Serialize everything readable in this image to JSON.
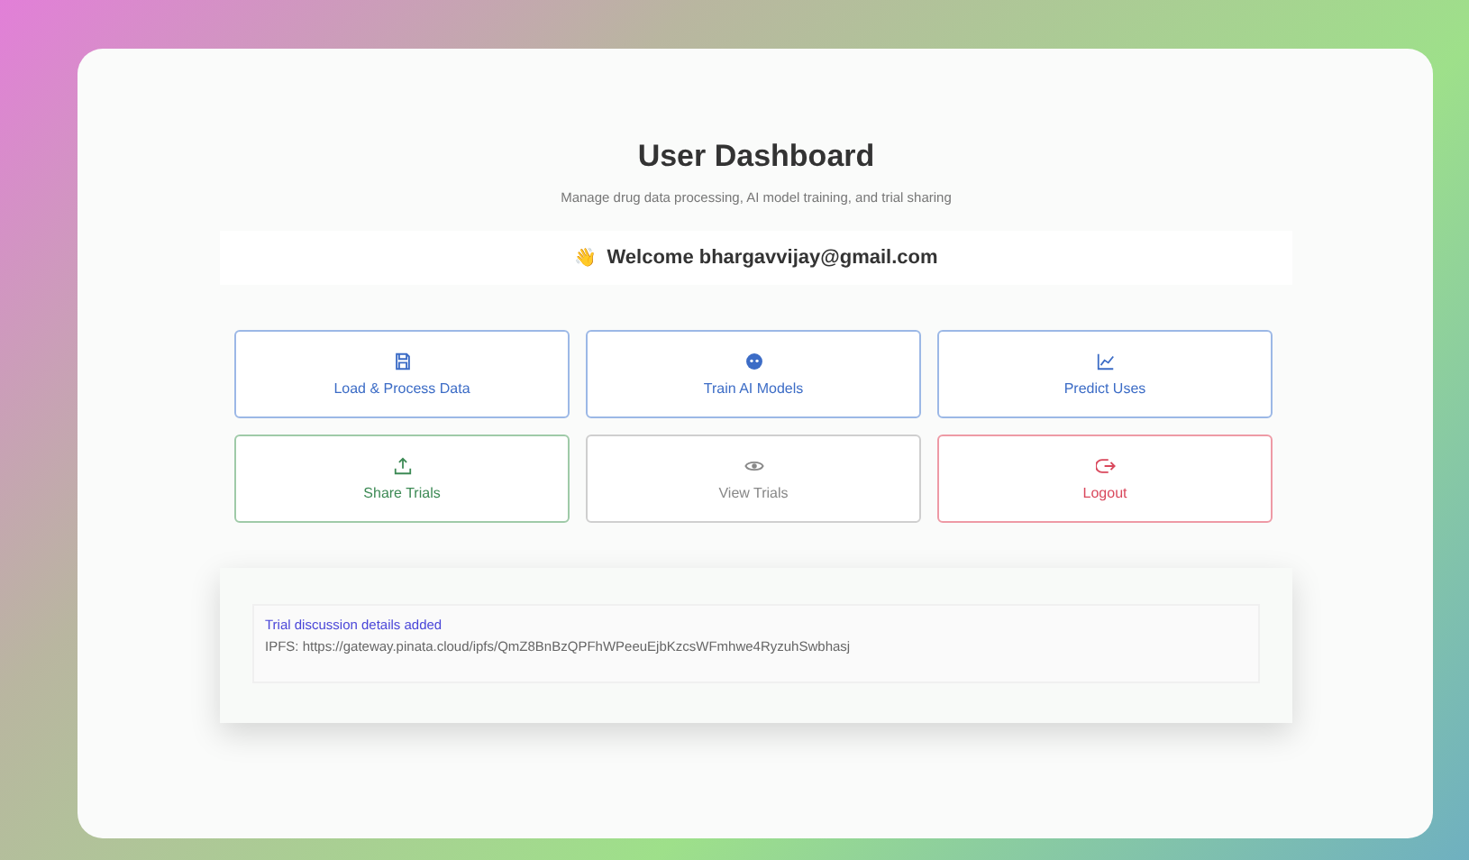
{
  "header": {
    "title": "User Dashboard",
    "subtitle": "Manage drug data processing, AI model training, and trial sharing"
  },
  "welcome": {
    "wave": "👋",
    "text": "Welcome bhargavvijay@gmail.com"
  },
  "actions": [
    {
      "label": "Load & Process Data",
      "kind": "primary"
    },
    {
      "label": "Train AI Models",
      "kind": "primary"
    },
    {
      "label": "Predict Uses",
      "kind": "primary"
    },
    {
      "label": "Share Trials",
      "kind": "success"
    },
    {
      "label": "View Trials",
      "kind": "neutral"
    },
    {
      "label": "Logout",
      "kind": "danger"
    }
  ],
  "message": {
    "title": "Trial discussion details added",
    "detail": "IPFS: https://gateway.pinata.cloud/ipfs/QmZ8BnBzQPFhWPeeuEjbKzcsWFmhwe4RyzuhSwbhasj"
  }
}
